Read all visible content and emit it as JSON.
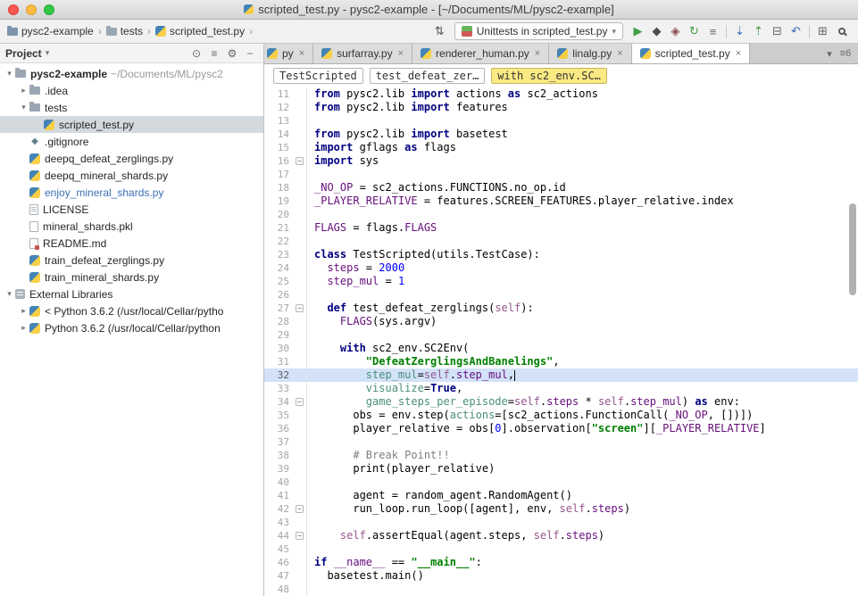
{
  "ui": {
    "caret": "▾",
    "chevron": "›",
    "close": "×",
    "fold": "−",
    "arrow_open": "▾",
    "arrow_closed": "▸"
  },
  "window": {
    "title": "scripted_test.py - pysc2-example - [~/Documents/ML/pysc2-example]"
  },
  "toolbar": {
    "breadcrumbs": [
      {
        "label": "pysc2-example",
        "icon": "project"
      },
      {
        "label": "tests",
        "icon": "folder"
      },
      {
        "label": "scripted_test.py",
        "icon": "python"
      }
    ],
    "nav_icon": "⇅",
    "run_config": {
      "label": "Unittests in scripted_test.py"
    },
    "icons": [
      {
        "name": "run-button",
        "glyph": "▶",
        "color": "#3f9d44"
      },
      {
        "name": "debug-button",
        "glyph": "◆",
        "color": "#4c4c4c"
      },
      {
        "name": "run-coverage-button",
        "glyph": "◈",
        "color": "#8a4a4a"
      },
      {
        "name": "rerun-button",
        "glyph": "↻",
        "color": "#3f9d44"
      },
      {
        "name": "filter-button",
        "glyph": "≡",
        "color": "#666666"
      },
      {
        "name": "sep"
      },
      {
        "name": "vcs-update-button",
        "glyph": "⇣",
        "color": "#3a6cb5"
      },
      {
        "name": "vcs-push-button",
        "glyph": "⇡",
        "color": "#3f9d44"
      },
      {
        "name": "diff-button",
        "glyph": "⊟",
        "color": "#666666"
      },
      {
        "name": "revert-button",
        "glyph": "↶",
        "color": "#3a6cb5"
      },
      {
        "name": "sep"
      },
      {
        "name": "tool-windows-button",
        "glyph": "⊞",
        "color": "#666666"
      },
      {
        "name": "search-everywhere-button",
        "glyph": "search",
        "color": "#555555"
      }
    ]
  },
  "project_panel": {
    "title": "Project",
    "header_icons": [
      {
        "name": "scroll-from-source-button",
        "glyph": "⊙"
      },
      {
        "name": "collapse-all-button",
        "glyph": "≡"
      },
      {
        "name": "settings-button",
        "glyph": "⚙"
      },
      {
        "name": "hide-panel-button",
        "glyph": "−"
      }
    ],
    "tree": [
      {
        "label": "pysc2-example",
        "suffix": "~/Documents/ML/pysc2",
        "level": 0,
        "icon": "folder",
        "arrow": "open",
        "bold": true
      },
      {
        "label": ".idea",
        "level": 1,
        "icon": "folder",
        "arrow": "closed"
      },
      {
        "label": "tests",
        "level": 1,
        "icon": "folder",
        "arrow": "open"
      },
      {
        "label": "scripted_test.py",
        "level": 2,
        "icon": "python",
        "selected": true
      },
      {
        "label": ".gitignore",
        "level": 1,
        "icon": "git"
      },
      {
        "label": "deepq_defeat_zerglings.py",
        "level": 1,
        "icon": "python"
      },
      {
        "label": "deepq_mineral_shards.py",
        "level": 1,
        "icon": "python"
      },
      {
        "label": "enjoy_mineral_shards.py",
        "level": 1,
        "icon": "python",
        "modified": true
      },
      {
        "label": "LICENSE",
        "level": 1,
        "icon": "text"
      },
      {
        "label": "mineral_shards.pkl",
        "level": 1,
        "icon": "file"
      },
      {
        "label": "README.md",
        "level": 1,
        "icon": "md"
      },
      {
        "label": "train_defeat_zerglings.py",
        "level": 1,
        "icon": "python"
      },
      {
        "label": "train_mineral_shards.py",
        "level": 1,
        "icon": "python"
      },
      {
        "label": "External Libraries",
        "level": 0,
        "icon": "lib",
        "arrow": "open"
      },
      {
        "label": "< Python 3.6.2 (/usr/local/Cellar/pytho",
        "level": 1,
        "icon": "python",
        "arrow": "closed"
      },
      {
        "label": "Python 3.6.2 (/usr/local/Cellar/python",
        "level": 1,
        "icon": "python",
        "arrow": "closed"
      }
    ]
  },
  "editor": {
    "tabs": [
      {
        "label": "py",
        "partial": true
      },
      {
        "label": "surfarray.py"
      },
      {
        "label": "renderer_human.py"
      },
      {
        "label": "linalg.py"
      },
      {
        "label": "scripted_test.py",
        "active": true
      }
    ],
    "tab_extras": [
      {
        "name": "hidden-tabs-button",
        "glyph": "▾"
      },
      {
        "name": "tabs-list-button",
        "glyph": "≡",
        "badge": "6"
      }
    ],
    "chips": [
      {
        "label": "TestScripted"
      },
      {
        "label": "test_defeat_zer…"
      },
      {
        "label": "with sc2_env.SC…",
        "highlighted": true
      }
    ],
    "current_line": 32,
    "lines": [
      {
        "n": 11,
        "t": [
          [
            "kw",
            "from"
          ],
          [
            "pl",
            " pysc2.lib "
          ],
          [
            "kw",
            "import"
          ],
          [
            "pl",
            " actions "
          ],
          [
            "kw",
            "as"
          ],
          [
            "pl",
            " sc2_actions"
          ]
        ]
      },
      {
        "n": 12,
        "t": [
          [
            "kw",
            "from"
          ],
          [
            "pl",
            " pysc2.lib "
          ],
          [
            "kw",
            "import"
          ],
          [
            "pl",
            " features"
          ]
        ]
      },
      {
        "n": 13,
        "t": []
      },
      {
        "n": 14,
        "t": [
          [
            "kw",
            "from"
          ],
          [
            "pl",
            " pysc2.lib "
          ],
          [
            "kw",
            "import"
          ],
          [
            "pl",
            " basetest"
          ]
        ]
      },
      {
        "n": 15,
        "t": [
          [
            "kw",
            "import"
          ],
          [
            "pl",
            " gflags "
          ],
          [
            "kw",
            "as"
          ],
          [
            "pl",
            " flags"
          ]
        ]
      },
      {
        "n": 16,
        "fold": true,
        "t": [
          [
            "kw",
            "import"
          ],
          [
            "pl",
            " sys"
          ]
        ]
      },
      {
        "n": 17,
        "t": []
      },
      {
        "n": 18,
        "t": [
          [
            "glob",
            "_NO_OP"
          ],
          [
            "pl",
            " = sc2_actions.FUNCTIONS.no_op.id"
          ]
        ]
      },
      {
        "n": 19,
        "t": [
          [
            "glob",
            "_PLAYER_RELATIVE"
          ],
          [
            "pl",
            " = features.SCREEN_FEATURES.player_relative.index"
          ]
        ]
      },
      {
        "n": 20,
        "t": []
      },
      {
        "n": 21,
        "t": [
          [
            "glob",
            "FLAGS"
          ],
          [
            "pl",
            " = flags."
          ],
          [
            "glob",
            "FLAGS"
          ]
        ]
      },
      {
        "n": 22,
        "t": []
      },
      {
        "n": 23,
        "t": [
          [
            "kw",
            "class"
          ],
          [
            "pl",
            " TestScripted(utils.TestCase):"
          ]
        ]
      },
      {
        "n": 24,
        "t": [
          [
            "pl",
            "  "
          ],
          [
            "glob",
            "steps"
          ],
          [
            "pl",
            " = "
          ],
          [
            "num",
            "2000"
          ]
        ]
      },
      {
        "n": 25,
        "t": [
          [
            "pl",
            "  "
          ],
          [
            "glob",
            "step_mul"
          ],
          [
            "pl",
            " = "
          ],
          [
            "num",
            "1"
          ]
        ]
      },
      {
        "n": 26,
        "t": []
      },
      {
        "n": 27,
        "fold": true,
        "t": [
          [
            "pl",
            "  "
          ],
          [
            "kw",
            "def"
          ],
          [
            "pl",
            " test_defeat_zerglings("
          ],
          [
            "self",
            "self"
          ],
          [
            "pl",
            "):"
          ]
        ]
      },
      {
        "n": 28,
        "t": [
          [
            "pl",
            "    "
          ],
          [
            "glob",
            "FLAGS"
          ],
          [
            "pl",
            "(sys.argv)"
          ]
        ]
      },
      {
        "n": 29,
        "t": []
      },
      {
        "n": 30,
        "t": [
          [
            "pl",
            "    "
          ],
          [
            "kw",
            "with"
          ],
          [
            "pl",
            " sc2_env.SC2Env("
          ]
        ]
      },
      {
        "n": 31,
        "t": [
          [
            "pl",
            "        "
          ],
          [
            "str",
            "\"DefeatZerglingsAndBanelings\""
          ],
          [
            "pl",
            ","
          ]
        ]
      },
      {
        "n": 32,
        "cursor": true,
        "t": [
          [
            "pl",
            "        "
          ],
          [
            "kwarg",
            "step_mul"
          ],
          [
            "pl",
            "="
          ],
          [
            "self",
            "self"
          ],
          [
            "pl",
            "."
          ],
          [
            "glob",
            "step_mul"
          ],
          [
            "pl",
            ","
          ]
        ]
      },
      {
        "n": 33,
        "t": [
          [
            "pl",
            "        "
          ],
          [
            "kwarg",
            "visualize"
          ],
          [
            "pl",
            "="
          ],
          [
            "kw",
            "True"
          ],
          [
            "pl",
            ","
          ]
        ]
      },
      {
        "n": 34,
        "fold": true,
        "t": [
          [
            "pl",
            "        "
          ],
          [
            "kwarg",
            "game_steps_per_episode"
          ],
          [
            "pl",
            "="
          ],
          [
            "self",
            "self"
          ],
          [
            "pl",
            "."
          ],
          [
            "glob",
            "steps"
          ],
          [
            "pl",
            " * "
          ],
          [
            "self",
            "self"
          ],
          [
            "pl",
            "."
          ],
          [
            "glob",
            "step_mul"
          ],
          [
            "pl",
            ") "
          ],
          [
            "kw",
            "as"
          ],
          [
            "pl",
            " env:"
          ]
        ]
      },
      {
        "n": 35,
        "t": [
          [
            "pl",
            "      obs = env.step("
          ],
          [
            "kwarg",
            "actions"
          ],
          [
            "pl",
            "=[sc2_actions.FunctionCall("
          ],
          [
            "glob",
            "_NO_OP"
          ],
          [
            "pl",
            ", [])])"
          ]
        ]
      },
      {
        "n": 36,
        "t": [
          [
            "pl",
            "      player_relative = obs["
          ],
          [
            "num",
            "0"
          ],
          [
            "pl",
            "].observation["
          ],
          [
            "str",
            "\"screen\""
          ],
          [
            "pl",
            "]["
          ],
          [
            "glob",
            "_PLAYER_RELATIVE"
          ],
          [
            "pl",
            "]"
          ]
        ]
      },
      {
        "n": 37,
        "t": []
      },
      {
        "n": 38,
        "t": [
          [
            "pl",
            "      "
          ],
          [
            "com",
            "# Break Point!!"
          ]
        ]
      },
      {
        "n": 39,
        "t": [
          [
            "pl",
            "      print(player_relative)"
          ]
        ]
      },
      {
        "n": 40,
        "t": []
      },
      {
        "n": 41,
        "t": [
          [
            "pl",
            "      agent = random_agent.RandomAgent()"
          ]
        ]
      },
      {
        "n": 42,
        "fold": true,
        "t": [
          [
            "pl",
            "      run_loop.run_loop([agent], env, "
          ],
          [
            "self",
            "self"
          ],
          [
            "pl",
            "."
          ],
          [
            "glob",
            "steps"
          ],
          [
            "pl",
            ")"
          ]
        ]
      },
      {
        "n": 43,
        "t": []
      },
      {
        "n": 44,
        "fold": true,
        "t": [
          [
            "pl",
            "    "
          ],
          [
            "self",
            "self"
          ],
          [
            "pl",
            ".assertEqual(agent.steps, "
          ],
          [
            "self",
            "self"
          ],
          [
            "pl",
            "."
          ],
          [
            "glob",
            "steps"
          ],
          [
            "pl",
            ")"
          ]
        ]
      },
      {
        "n": 45,
        "t": []
      },
      {
        "n": 46,
        "t": [
          [
            "kw",
            "if"
          ],
          [
            "pl",
            " "
          ],
          [
            "glob",
            "__name__"
          ],
          [
            "pl",
            " == "
          ],
          [
            "str",
            "\"__main__\""
          ],
          [
            "pl",
            ":"
          ]
        ]
      },
      {
        "n": 47,
        "t": [
          [
            "pl",
            "  basetest.main()"
          ]
        ]
      },
      {
        "n": 48,
        "t": []
      }
    ]
  }
}
